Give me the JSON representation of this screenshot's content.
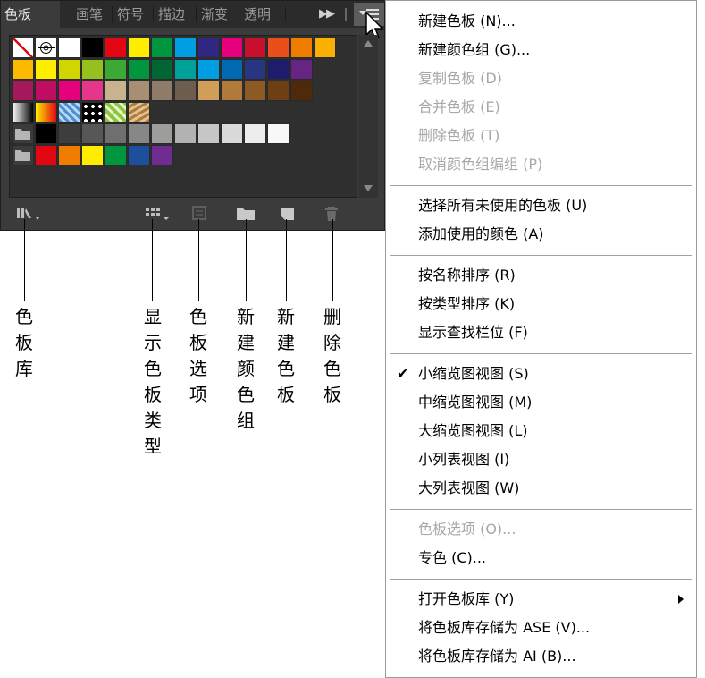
{
  "panel": {
    "tabs": [
      "色板",
      "画笔",
      "符号",
      "描边",
      "渐变",
      "透明"
    ],
    "swatch_rows": [
      [
        "none",
        "registration",
        "#ffffff",
        "#000000",
        "#e30613",
        "#ffed00",
        "#009640",
        "#009fe3",
        "#312783",
        "#e6007e",
        "#c8102e",
        "#e94e1b",
        "#ef7d00",
        "#f9b000"
      ],
      [
        "#fbba00",
        "#ffed00",
        "#cfd600",
        "#95c11f",
        "#3aaa35",
        "#009640",
        "#006633",
        "#00a19a",
        "#009fe3",
        "#0069b4",
        "#283583",
        "#1d1d6b",
        "#662483"
      ],
      [
        "#a3195b",
        "#c00d62",
        "#e5007d",
        "#e4368a",
        "#c8b38e",
        "#a78f76",
        "#8e7b69",
        "#6e5e50",
        "#d19e59",
        "#b07a3a",
        "#8c5a22",
        "#6e3f13",
        "#4e2a0a"
      ],
      [
        "gradient-gray",
        "gradient-orange",
        "pattern-blue",
        "pattern-dots",
        "pattern-green",
        "pattern-brown"
      ],
      [
        "folder",
        "#000000",
        "#3d3d3d",
        "#575757",
        "#706f6f",
        "#878787",
        "#9d9d9c",
        "#b2b2b2",
        "#c6c6c6",
        "#dadada",
        "#ededed",
        "#f8f8f8"
      ],
      [
        "folder",
        "#e30613",
        "#ef7d00",
        "#ffed00",
        "#009640",
        "#1d4f9c",
        "#6f2c91"
      ]
    ]
  },
  "callouts": {
    "library": "色板库",
    "show_kind": "显示色板类型",
    "swatch_options": "色板选项",
    "new_group": "新建颜色组",
    "new_swatch": "新建色板",
    "delete_swatch": "删除色板"
  },
  "menu": {
    "items": [
      {
        "label": "新建色板 (N)...",
        "disabled": false
      },
      {
        "label": "新建颜色组 (G)...",
        "disabled": false
      },
      {
        "label": "复制色板 (D)",
        "disabled": true
      },
      {
        "label": "合并色板 (E)",
        "disabled": true
      },
      {
        "label": "删除色板 (T)",
        "disabled": true
      },
      {
        "label": "取消颜色组编组 (P)",
        "disabled": true
      },
      {
        "label": "选择所有未使用的色板 (U)",
        "disabled": false
      },
      {
        "label": "添加使用的颜色 (A)",
        "disabled": false
      },
      {
        "label": "按名称排序 (R)",
        "disabled": false
      },
      {
        "label": "按类型排序 (K)",
        "disabled": false
      },
      {
        "label": "显示查找栏位 (F)",
        "disabled": false
      },
      {
        "label": "小缩览图视图 (S)",
        "disabled": false,
        "checked": true
      },
      {
        "label": "中缩览图视图 (M)",
        "disabled": false
      },
      {
        "label": "大缩览图视图 (L)",
        "disabled": false
      },
      {
        "label": "小列表视图 (I)",
        "disabled": false
      },
      {
        "label": "大列表视图 (W)",
        "disabled": false
      },
      {
        "label": "色板选项 (O)...",
        "disabled": true
      },
      {
        "label": "专色 (C)...",
        "disabled": false
      },
      {
        "label": "打开色板库 (Y)",
        "disabled": false,
        "submenu": true
      },
      {
        "label": "将色板库存储为 ASE (V)...",
        "disabled": false
      },
      {
        "label": "将色板库存储为 AI (B)...",
        "disabled": false
      }
    ]
  },
  "colors": {
    "panel_bg": "#3b3b3b",
    "tabbar_bg": "#2b2b2b",
    "disabled_text": "#a8a8a8"
  }
}
